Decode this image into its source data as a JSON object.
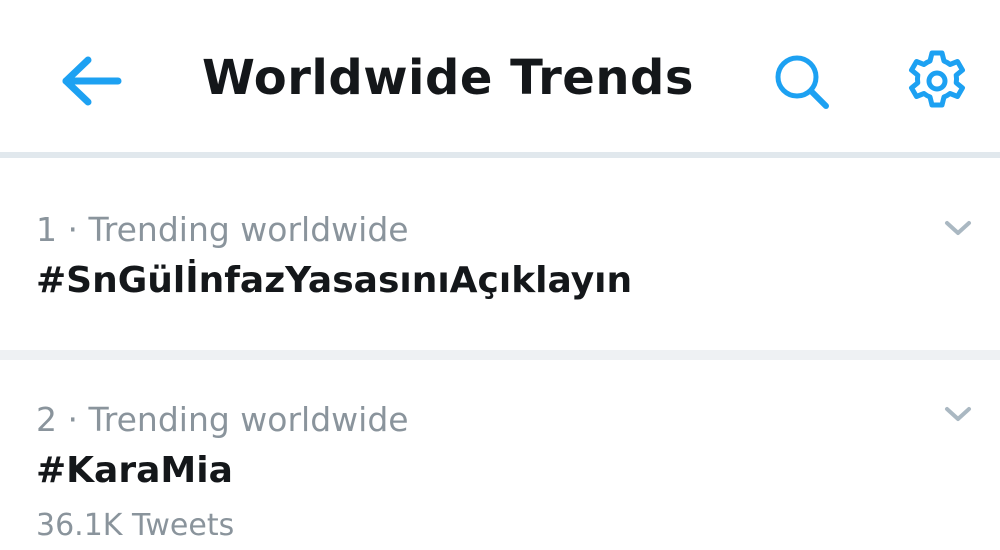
{
  "header": {
    "title": "Worldwide Trends",
    "back_icon": "arrow-left-icon",
    "search_icon": "search-icon",
    "settings_icon": "gear-icon",
    "accent_color": "#1da1f2"
  },
  "trends": [
    {
      "context": "1 · Trending worldwide",
      "name": "#SnGülİnfazYasasınıAçıklayın",
      "tweet_count": ""
    },
    {
      "context": "2 · Trending worldwide",
      "name": "#KaraMia",
      "tweet_count": "36.1K Tweets"
    }
  ]
}
